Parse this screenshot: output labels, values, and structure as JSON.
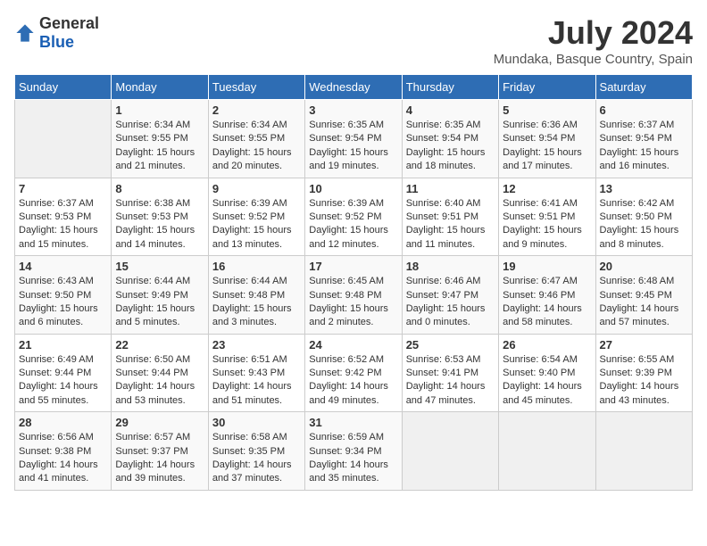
{
  "header": {
    "logo_general": "General",
    "logo_blue": "Blue",
    "title": "July 2024",
    "subtitle": "Mundaka, Basque Country, Spain"
  },
  "days_of_week": [
    "Sunday",
    "Monday",
    "Tuesday",
    "Wednesday",
    "Thursday",
    "Friday",
    "Saturday"
  ],
  "weeks": [
    [
      {
        "day": "",
        "sunrise": "",
        "sunset": "",
        "daylight": ""
      },
      {
        "day": "1",
        "sunrise": "Sunrise: 6:34 AM",
        "sunset": "Sunset: 9:55 PM",
        "daylight": "Daylight: 15 hours and 21 minutes."
      },
      {
        "day": "2",
        "sunrise": "Sunrise: 6:34 AM",
        "sunset": "Sunset: 9:55 PM",
        "daylight": "Daylight: 15 hours and 20 minutes."
      },
      {
        "day": "3",
        "sunrise": "Sunrise: 6:35 AM",
        "sunset": "Sunset: 9:54 PM",
        "daylight": "Daylight: 15 hours and 19 minutes."
      },
      {
        "day": "4",
        "sunrise": "Sunrise: 6:35 AM",
        "sunset": "Sunset: 9:54 PM",
        "daylight": "Daylight: 15 hours and 18 minutes."
      },
      {
        "day": "5",
        "sunrise": "Sunrise: 6:36 AM",
        "sunset": "Sunset: 9:54 PM",
        "daylight": "Daylight: 15 hours and 17 minutes."
      },
      {
        "day": "6",
        "sunrise": "Sunrise: 6:37 AM",
        "sunset": "Sunset: 9:54 PM",
        "daylight": "Daylight: 15 hours and 16 minutes."
      }
    ],
    [
      {
        "day": "7",
        "sunrise": "Sunrise: 6:37 AM",
        "sunset": "Sunset: 9:53 PM",
        "daylight": "Daylight: 15 hours and 15 minutes."
      },
      {
        "day": "8",
        "sunrise": "Sunrise: 6:38 AM",
        "sunset": "Sunset: 9:53 PM",
        "daylight": "Daylight: 15 hours and 14 minutes."
      },
      {
        "day": "9",
        "sunrise": "Sunrise: 6:39 AM",
        "sunset": "Sunset: 9:52 PM",
        "daylight": "Daylight: 15 hours and 13 minutes."
      },
      {
        "day": "10",
        "sunrise": "Sunrise: 6:39 AM",
        "sunset": "Sunset: 9:52 PM",
        "daylight": "Daylight: 15 hours and 12 minutes."
      },
      {
        "day": "11",
        "sunrise": "Sunrise: 6:40 AM",
        "sunset": "Sunset: 9:51 PM",
        "daylight": "Daylight: 15 hours and 11 minutes."
      },
      {
        "day": "12",
        "sunrise": "Sunrise: 6:41 AM",
        "sunset": "Sunset: 9:51 PM",
        "daylight": "Daylight: 15 hours and 9 minutes."
      },
      {
        "day": "13",
        "sunrise": "Sunrise: 6:42 AM",
        "sunset": "Sunset: 9:50 PM",
        "daylight": "Daylight: 15 hours and 8 minutes."
      }
    ],
    [
      {
        "day": "14",
        "sunrise": "Sunrise: 6:43 AM",
        "sunset": "Sunset: 9:50 PM",
        "daylight": "Daylight: 15 hours and 6 minutes."
      },
      {
        "day": "15",
        "sunrise": "Sunrise: 6:44 AM",
        "sunset": "Sunset: 9:49 PM",
        "daylight": "Daylight: 15 hours and 5 minutes."
      },
      {
        "day": "16",
        "sunrise": "Sunrise: 6:44 AM",
        "sunset": "Sunset: 9:48 PM",
        "daylight": "Daylight: 15 hours and 3 minutes."
      },
      {
        "day": "17",
        "sunrise": "Sunrise: 6:45 AM",
        "sunset": "Sunset: 9:48 PM",
        "daylight": "Daylight: 15 hours and 2 minutes."
      },
      {
        "day": "18",
        "sunrise": "Sunrise: 6:46 AM",
        "sunset": "Sunset: 9:47 PM",
        "daylight": "Daylight: 15 hours and 0 minutes."
      },
      {
        "day": "19",
        "sunrise": "Sunrise: 6:47 AM",
        "sunset": "Sunset: 9:46 PM",
        "daylight": "Daylight: 14 hours and 58 minutes."
      },
      {
        "day": "20",
        "sunrise": "Sunrise: 6:48 AM",
        "sunset": "Sunset: 9:45 PM",
        "daylight": "Daylight: 14 hours and 57 minutes."
      }
    ],
    [
      {
        "day": "21",
        "sunrise": "Sunrise: 6:49 AM",
        "sunset": "Sunset: 9:44 PM",
        "daylight": "Daylight: 14 hours and 55 minutes."
      },
      {
        "day": "22",
        "sunrise": "Sunrise: 6:50 AM",
        "sunset": "Sunset: 9:44 PM",
        "daylight": "Daylight: 14 hours and 53 minutes."
      },
      {
        "day": "23",
        "sunrise": "Sunrise: 6:51 AM",
        "sunset": "Sunset: 9:43 PM",
        "daylight": "Daylight: 14 hours and 51 minutes."
      },
      {
        "day": "24",
        "sunrise": "Sunrise: 6:52 AM",
        "sunset": "Sunset: 9:42 PM",
        "daylight": "Daylight: 14 hours and 49 minutes."
      },
      {
        "day": "25",
        "sunrise": "Sunrise: 6:53 AM",
        "sunset": "Sunset: 9:41 PM",
        "daylight": "Daylight: 14 hours and 47 minutes."
      },
      {
        "day": "26",
        "sunrise": "Sunrise: 6:54 AM",
        "sunset": "Sunset: 9:40 PM",
        "daylight": "Daylight: 14 hours and 45 minutes."
      },
      {
        "day": "27",
        "sunrise": "Sunrise: 6:55 AM",
        "sunset": "Sunset: 9:39 PM",
        "daylight": "Daylight: 14 hours and 43 minutes."
      }
    ],
    [
      {
        "day": "28",
        "sunrise": "Sunrise: 6:56 AM",
        "sunset": "Sunset: 9:38 PM",
        "daylight": "Daylight: 14 hours and 41 minutes."
      },
      {
        "day": "29",
        "sunrise": "Sunrise: 6:57 AM",
        "sunset": "Sunset: 9:37 PM",
        "daylight": "Daylight: 14 hours and 39 minutes."
      },
      {
        "day": "30",
        "sunrise": "Sunrise: 6:58 AM",
        "sunset": "Sunset: 9:35 PM",
        "daylight": "Daylight: 14 hours and 37 minutes."
      },
      {
        "day": "31",
        "sunrise": "Sunrise: 6:59 AM",
        "sunset": "Sunset: 9:34 PM",
        "daylight": "Daylight: 14 hours and 35 minutes."
      },
      {
        "day": "",
        "sunrise": "",
        "sunset": "",
        "daylight": ""
      },
      {
        "day": "",
        "sunrise": "",
        "sunset": "",
        "daylight": ""
      },
      {
        "day": "",
        "sunrise": "",
        "sunset": "",
        "daylight": ""
      }
    ]
  ]
}
